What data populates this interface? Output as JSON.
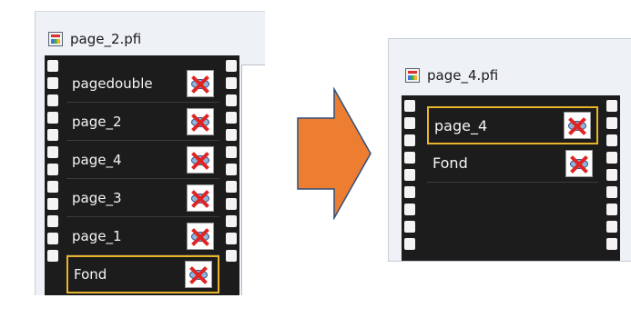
{
  "left_window": {
    "title": "page_2.pfi",
    "layers": [
      {
        "name": "pagedouble",
        "selected": false
      },
      {
        "name": "page_2",
        "selected": false
      },
      {
        "name": "page_4",
        "selected": false
      },
      {
        "name": "page_3",
        "selected": false
      },
      {
        "name": "page_1",
        "selected": false
      },
      {
        "name": "Fond",
        "selected": true
      }
    ]
  },
  "right_window": {
    "title": "page_4.pfi",
    "layers": [
      {
        "name": "page_4",
        "selected": true
      },
      {
        "name": "Fond",
        "selected": false
      }
    ]
  },
  "colors": {
    "film": "#1c1c1c",
    "selection": "#e8b52a",
    "arrow": "#ed7d31",
    "cross": "#e02424"
  },
  "icons": {
    "document": "pfi-document-icon",
    "visibility": "eye-hidden-icon",
    "transition": "arrow-right-icon"
  }
}
